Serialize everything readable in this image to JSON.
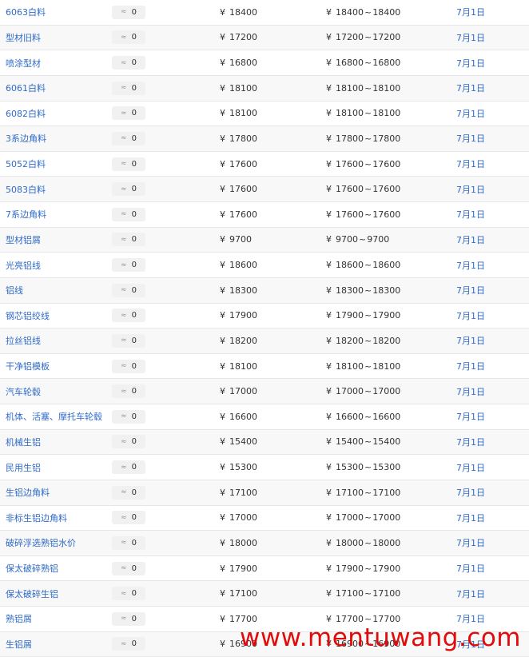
{
  "rows": [
    {
      "name": "6063白料",
      "change": "0",
      "price": "18400",
      "range_low": "18400",
      "range_high": "18400",
      "date": "7月1日"
    },
    {
      "name": "型材旧料",
      "change": "0",
      "price": "17200",
      "range_low": "17200",
      "range_high": "17200",
      "date": "7月1日"
    },
    {
      "name": "喷涂型材",
      "change": "0",
      "price": "16800",
      "range_low": "16800",
      "range_high": "16800",
      "date": "7月1日"
    },
    {
      "name": "6061白料",
      "change": "0",
      "price": "18100",
      "range_low": "18100",
      "range_high": "18100",
      "date": "7月1日"
    },
    {
      "name": "6082白料",
      "change": "0",
      "price": "18100",
      "range_low": "18100",
      "range_high": "18100",
      "date": "7月1日"
    },
    {
      "name": "3系边角料",
      "change": "0",
      "price": "17800",
      "range_low": "17800",
      "range_high": "17800",
      "date": "7月1日"
    },
    {
      "name": "5052白料",
      "change": "0",
      "price": "17600",
      "range_low": "17600",
      "range_high": "17600",
      "date": "7月1日"
    },
    {
      "name": "5083白料",
      "change": "0",
      "price": "17600",
      "range_low": "17600",
      "range_high": "17600",
      "date": "7月1日"
    },
    {
      "name": "7系边角料",
      "change": "0",
      "price": "17600",
      "range_low": "17600",
      "range_high": "17600",
      "date": "7月1日"
    },
    {
      "name": "型材铝屑",
      "change": "0",
      "price": "9700",
      "range_low": "9700",
      "range_high": "9700",
      "date": "7月1日"
    },
    {
      "name": "光亮铝线",
      "change": "0",
      "price": "18600",
      "range_low": "18600",
      "range_high": "18600",
      "date": "7月1日"
    },
    {
      "name": "铝线",
      "change": "0",
      "price": "18300",
      "range_low": "18300",
      "range_high": "18300",
      "date": "7月1日"
    },
    {
      "name": "钢芯铝绞线",
      "change": "0",
      "price": "17900",
      "range_low": "17900",
      "range_high": "17900",
      "date": "7月1日"
    },
    {
      "name": "拉丝铝线",
      "change": "0",
      "price": "18200",
      "range_low": "18200",
      "range_high": "18200",
      "date": "7月1日"
    },
    {
      "name": "干净铝模板",
      "change": "0",
      "price": "18100",
      "range_low": "18100",
      "range_high": "18100",
      "date": "7月1日"
    },
    {
      "name": "汽车轮毂",
      "change": "0",
      "price": "17000",
      "range_low": "17000",
      "range_high": "17000",
      "date": "7月1日"
    },
    {
      "name": "机体、活塞、摩托车轮毂",
      "change": "0",
      "price": "16600",
      "range_low": "16600",
      "range_high": "16600",
      "date": "7月1日"
    },
    {
      "name": "机械生铝",
      "change": "0",
      "price": "15400",
      "range_low": "15400",
      "range_high": "15400",
      "date": "7月1日"
    },
    {
      "name": "民用生铝",
      "change": "0",
      "price": "15300",
      "range_low": "15300",
      "range_high": "15300",
      "date": "7月1日"
    },
    {
      "name": "生铝边角料",
      "change": "0",
      "price": "17100",
      "range_low": "17100",
      "range_high": "17100",
      "date": "7月1日"
    },
    {
      "name": "非标生铝边角料",
      "change": "0",
      "price": "17000",
      "range_low": "17000",
      "range_high": "17000",
      "date": "7月1日"
    },
    {
      "name": "破碎浮选熟铝水价",
      "change": "0",
      "price": "18000",
      "range_low": "18000",
      "range_high": "18000",
      "date": "7月1日"
    },
    {
      "name": "保太破碎熟铝",
      "change": "0",
      "price": "17900",
      "range_low": "17900",
      "range_high": "17900",
      "date": "7月1日"
    },
    {
      "name": "保太破碎生铝",
      "change": "0",
      "price": "17100",
      "range_low": "17100",
      "range_high": "17100",
      "date": "7月1日"
    },
    {
      "name": "熟铝屑",
      "change": "0",
      "price": "17700",
      "range_low": "17700",
      "range_high": "17700",
      "date": "7月1日"
    },
    {
      "name": "生铝屑",
      "change": "0",
      "price": "16900",
      "range_low": "16900",
      "range_high": "16900",
      "date": "7月1日"
    }
  ],
  "currency_symbol": "¥",
  "range_separator": "~",
  "flat_icon": "≈",
  "watermark": "www.mentuwang.com",
  "colors": {
    "link": "#2f6bc8",
    "text": "#333333",
    "watermark": "#e10b0b"
  }
}
